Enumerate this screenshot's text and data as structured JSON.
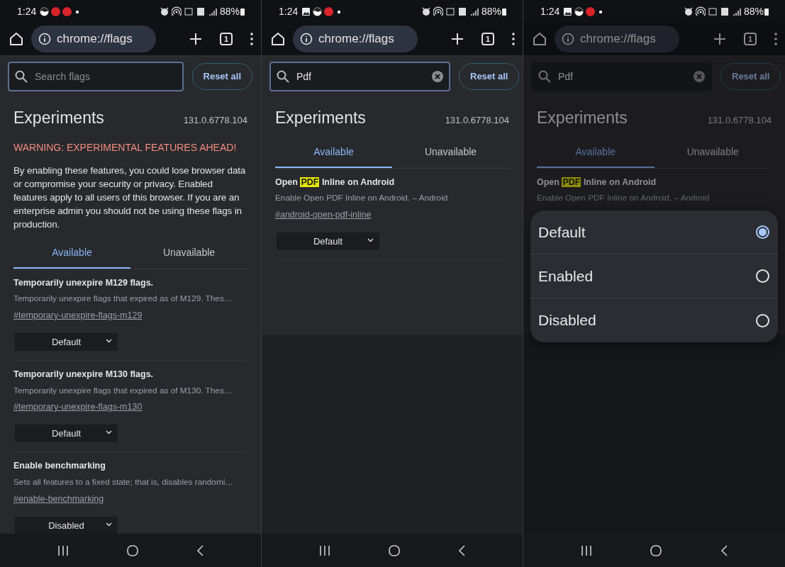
{
  "panels": [
    {
      "dimmed": false,
      "status_bar": {
        "time": "1:24",
        "notifications": [
          {
            "kind": "yin-yang"
          },
          {
            "kind": "jio"
          },
          {
            "kind": "jio"
          },
          {
            "kind": "dot"
          }
        ],
        "battery": "88%"
      },
      "toolbar": {
        "url": "chrome://flags",
        "tab_count": "1"
      },
      "search": {
        "placeholder": "Search flags",
        "focused": true
      },
      "reset_label": "Reset all",
      "page": {
        "title": "Experiments",
        "version": "131.0.6778.104",
        "warning": "WARNING: EXPERIMENTAL FEATURES AHEAD!",
        "intro": "By enabling these features, you could lose browser data or compromise your security or privacy. Enabled features apply to all users of this browser. If you are an enterprise admin you should not be using these flags in production.",
        "tabs": [
          {
            "label": "Available",
            "selected": true
          },
          {
            "label": "Unavailable",
            "selected": false
          }
        ],
        "flags": [
          {
            "title_parts": [
              {
                "text": "Temporarily unexpire M129 flags.",
                "highlighted": false
              }
            ],
            "description": "Temporarily unexpire flags that expired as of M129. Thes…",
            "link": "#temporary-unexpire-flags-m129",
            "value": "Default"
          },
          {
            "title_parts": [
              {
                "text": "Temporarily unexpire M130 flags.",
                "highlighted": false
              }
            ],
            "description": "Temporarily unexpire flags that expired as of M130. Thes…",
            "link": "#temporary-unexpire-flags-m130",
            "value": "Default"
          },
          {
            "title_parts": [
              {
                "text": "Enable benchmarking",
                "highlighted": false
              }
            ],
            "description": "Sets all features to a fixed state; that is, disables randomi…",
            "link": "#enable-benchmarking",
            "value": "Disabled"
          }
        ]
      }
    },
    {
      "dimmed": false,
      "status_bar": {
        "time": "1:24",
        "notifications": [
          {
            "kind": "gallery"
          },
          {
            "kind": "yin-yang"
          },
          {
            "kind": "jio"
          },
          {
            "kind": "dot"
          }
        ],
        "battery": "88%"
      },
      "toolbar": {
        "url": "chrome://flags",
        "tab_count": "1"
      },
      "search": {
        "value": "Pdf",
        "focused": true
      },
      "reset_label": "Reset all",
      "page": {
        "title": "Experiments",
        "version": "131.0.6778.104",
        "tabs": [
          {
            "label": "Available",
            "selected": true
          },
          {
            "label": "Unavailable",
            "selected": false
          }
        ],
        "flags": [
          {
            "title_parts": [
              {
                "text": "Open ",
                "highlighted": false
              },
              {
                "text": "PDF",
                "highlighted": true
              },
              {
                "text": " Inline on Android",
                "highlighted": false
              }
            ],
            "description": "Enable Open PDF Inline on Android. – Android",
            "link": "#android-open-pdf-inline",
            "value": "Default"
          }
        ]
      }
    },
    {
      "dimmed": true,
      "status_bar": {
        "time": "1:24",
        "notifications": [
          {
            "kind": "gallery"
          },
          {
            "kind": "yin-yang"
          },
          {
            "kind": "jio"
          },
          {
            "kind": "dot"
          }
        ],
        "battery": "88%"
      },
      "toolbar": {
        "url": "chrome://flags",
        "tab_count": "1"
      },
      "search": {
        "value": "Pdf",
        "focused": false
      },
      "reset_label": "Reset all",
      "page": {
        "title": "Experiments",
        "version": "131.0.6778.104",
        "tabs": [
          {
            "label": "Available",
            "selected": true
          },
          {
            "label": "Unavailable",
            "selected": false
          }
        ],
        "flags": [
          {
            "title_parts": [
              {
                "text": "Open ",
                "highlighted": false
              },
              {
                "text": "PDF",
                "highlighted": true
              },
              {
                "text": " Inline on Android",
                "highlighted": false
              }
            ],
            "description": "Enable Open PDF Inline on Android. – Android"
          }
        ]
      },
      "popup": {
        "options": [
          {
            "label": "Default",
            "selected": true
          },
          {
            "label": "Enabled",
            "selected": false
          },
          {
            "label": "Disabled",
            "selected": false
          }
        ]
      }
    }
  ]
}
